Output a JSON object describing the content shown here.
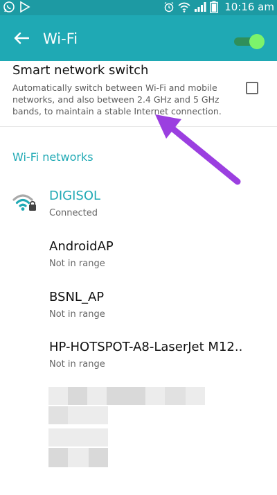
{
  "status_bar": {
    "time": "10:16 am",
    "background": "#1d9aa3"
  },
  "app_bar": {
    "title": "Wi-Fi",
    "background": "#1fa9b4",
    "toggle_on": true,
    "toggle_color": "#7cf36b"
  },
  "smart_switch": {
    "title": "Smart network switch",
    "description": "Automatically switch between Wi-Fi and mobile networks, and also between 2.4 GHz and 5 GHz bands, to maintain a stable Internet connection.",
    "checked": false
  },
  "networks": {
    "header": "Wi-Fi networks",
    "accent": "#1fa9b4",
    "items": [
      {
        "name": "DIGISOL",
        "status": "Connected",
        "icon": "wifi-lock-icon"
      },
      {
        "name": "AndroidAP",
        "status": "Not in range"
      },
      {
        "name": "BSNL_AP",
        "status": "Not in range"
      },
      {
        "name": "HP-HOTSPOT-A8-LaserJet M12..",
        "status": "Not in range"
      }
    ]
  },
  "annotation": {
    "arrow_color": "#9b3fe0"
  }
}
